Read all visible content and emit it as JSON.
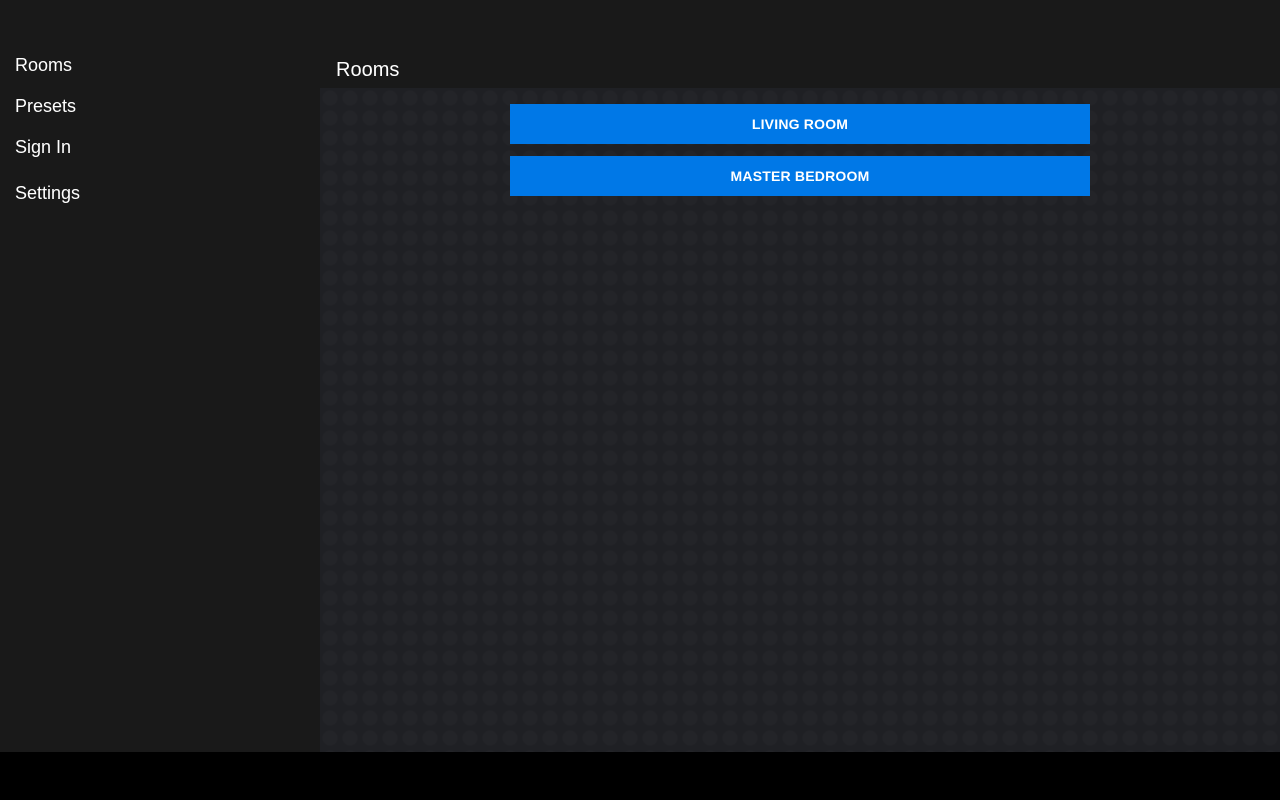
{
  "sidebar": {
    "items": [
      {
        "label": "Rooms"
      },
      {
        "label": "Presets"
      },
      {
        "label": "Sign In"
      },
      {
        "label": "Settings"
      }
    ]
  },
  "header": {
    "title": "Rooms"
  },
  "rooms": [
    {
      "label": "LIVING ROOM"
    },
    {
      "label": "MASTER BEDROOM"
    }
  ],
  "colors": {
    "background": "#191919",
    "content_background": "#1f2024",
    "accent": "#0078e7",
    "text": "#ffffff",
    "navigation_bar": "#000000"
  }
}
